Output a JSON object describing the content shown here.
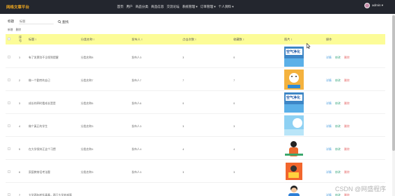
{
  "app": {
    "brand": "网络文章平台"
  },
  "nav": [
    {
      "label": "首页"
    },
    {
      "label": "用户"
    },
    {
      "label": "商品分类"
    },
    {
      "label": "商品信息"
    },
    {
      "label": "交流论坛"
    },
    {
      "label": "系统管理 ▾"
    },
    {
      "label": "订单管理 ▾"
    },
    {
      "label": "个人资料 ▾"
    }
  ],
  "user": {
    "name": "admin ▾"
  },
  "search": {
    "label": "标题",
    "placeholder": "标题",
    "button": "查找"
  },
  "actions": {
    "add": "新增",
    "delete": "删除"
  },
  "table": {
    "columns": {
      "index": "序号",
      "title": "标题 ↕",
      "category": "分类名称 ↕",
      "author": "发布人 ↕",
      "clicks": "点击次数 ↕",
      "favorites": "收藏数 ↕",
      "image": "图片 ↕",
      "ops": "操作"
    },
    "rows": [
      {
        "index": "1",
        "title": "有了发票别不当领到提醒",
        "category": "分类名称8",
        "author": "发布人3",
        "clicks": "3",
        "favorites": "0"
      },
      {
        "index": "2",
        "title": "做一个勤劳的自己",
        "category": "分类名称7",
        "author": "发布人7",
        "clicks": "7",
        "favorites": "7"
      },
      {
        "index": "3",
        "title": "成长的四时看成长是是",
        "category": "分类名称6",
        "author": "发布人6",
        "clicks": "0",
        "favorites": "0"
      },
      {
        "index": "4",
        "title": "做个真正的学生",
        "category": "分类名称3",
        "author": "发布人3",
        "clicks": "3",
        "favorites": "3"
      },
      {
        "index": "5",
        "title": "在大学保持正这个习惯",
        "category": "分类名称4",
        "author": "发布人4",
        "clicks": "4",
        "favorites": "4"
      },
      {
        "index": "6",
        "title": "家庭教育话考法题",
        "category": "分类名称3",
        "author": "发布人3",
        "clicks": "3",
        "favorites": "3"
      },
      {
        "index": "7",
        "title": "大学两年转折青春，两只大学结成帮",
        "category": "",
        "author": "",
        "clicks": "",
        "favorites": ""
      }
    ],
    "op_labels": {
      "detail": "详情",
      "edit": "修改",
      "delete": "删除"
    }
  },
  "thumbs": [
    {
      "caption": "空气净化"
    },
    {
      "caption": ""
    },
    {
      "caption": "空气净化"
    },
    {
      "caption": ""
    },
    {
      "caption": ""
    },
    {
      "caption": ""
    },
    {
      "caption": ""
    }
  ],
  "watermark": "CSDN @网盛程序",
  "colors": {
    "topbar": "#23262e",
    "brand": "#f0a820",
    "header_row": "#fcfc98",
    "op_detail": "#4a9cde",
    "op_edit": "#3aa67e",
    "op_delete": "#e66a6a"
  }
}
